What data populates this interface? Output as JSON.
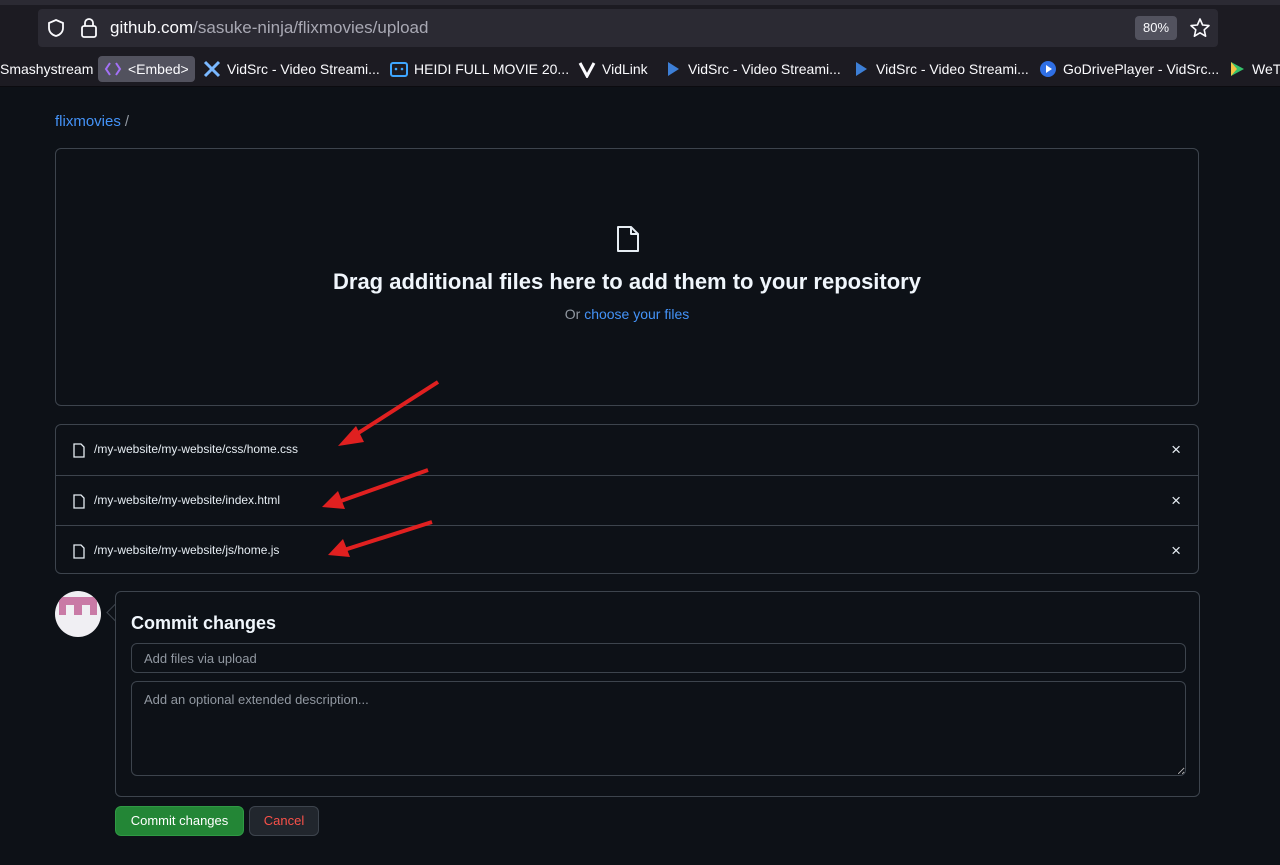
{
  "browser": {
    "url_host": "github.com",
    "url_path": "/sasuke-ninja/flixmovies/upload",
    "zoom": "80%",
    "bookmarks": [
      "Smashystream",
      "<Embed>",
      "VidSrc - Video Streami...",
      "HEIDI FULL MOVIE 20...",
      "VidLink",
      "VidSrc - Video Streami...",
      "VidSrc - Video Streami...",
      "GoDrivePlayer - VidSrc...",
      "WeT"
    ]
  },
  "breadcrumb": {
    "repo": "flixmovies",
    "separator": "/"
  },
  "dropzone": {
    "title": "Drag additional files here to add them to your repository",
    "or_text": "Or",
    "choose_link": "choose your files"
  },
  "files": [
    "/my-website/my-website/css/home.css",
    "/my-website/my-website/index.html",
    "/my-website/my-website/js/home.js"
  ],
  "remove_icon": "×",
  "commit": {
    "title": "Commit changes",
    "summary_placeholder": "Add files via upload",
    "description_placeholder": "Add an optional extended description...",
    "commit_button": "Commit changes",
    "cancel_button": "Cancel"
  },
  "colors": {
    "accent_link": "#4493f8",
    "primary_button": "#238636",
    "cancel_text": "#f85149",
    "annotation_arrow": "#e02020"
  }
}
